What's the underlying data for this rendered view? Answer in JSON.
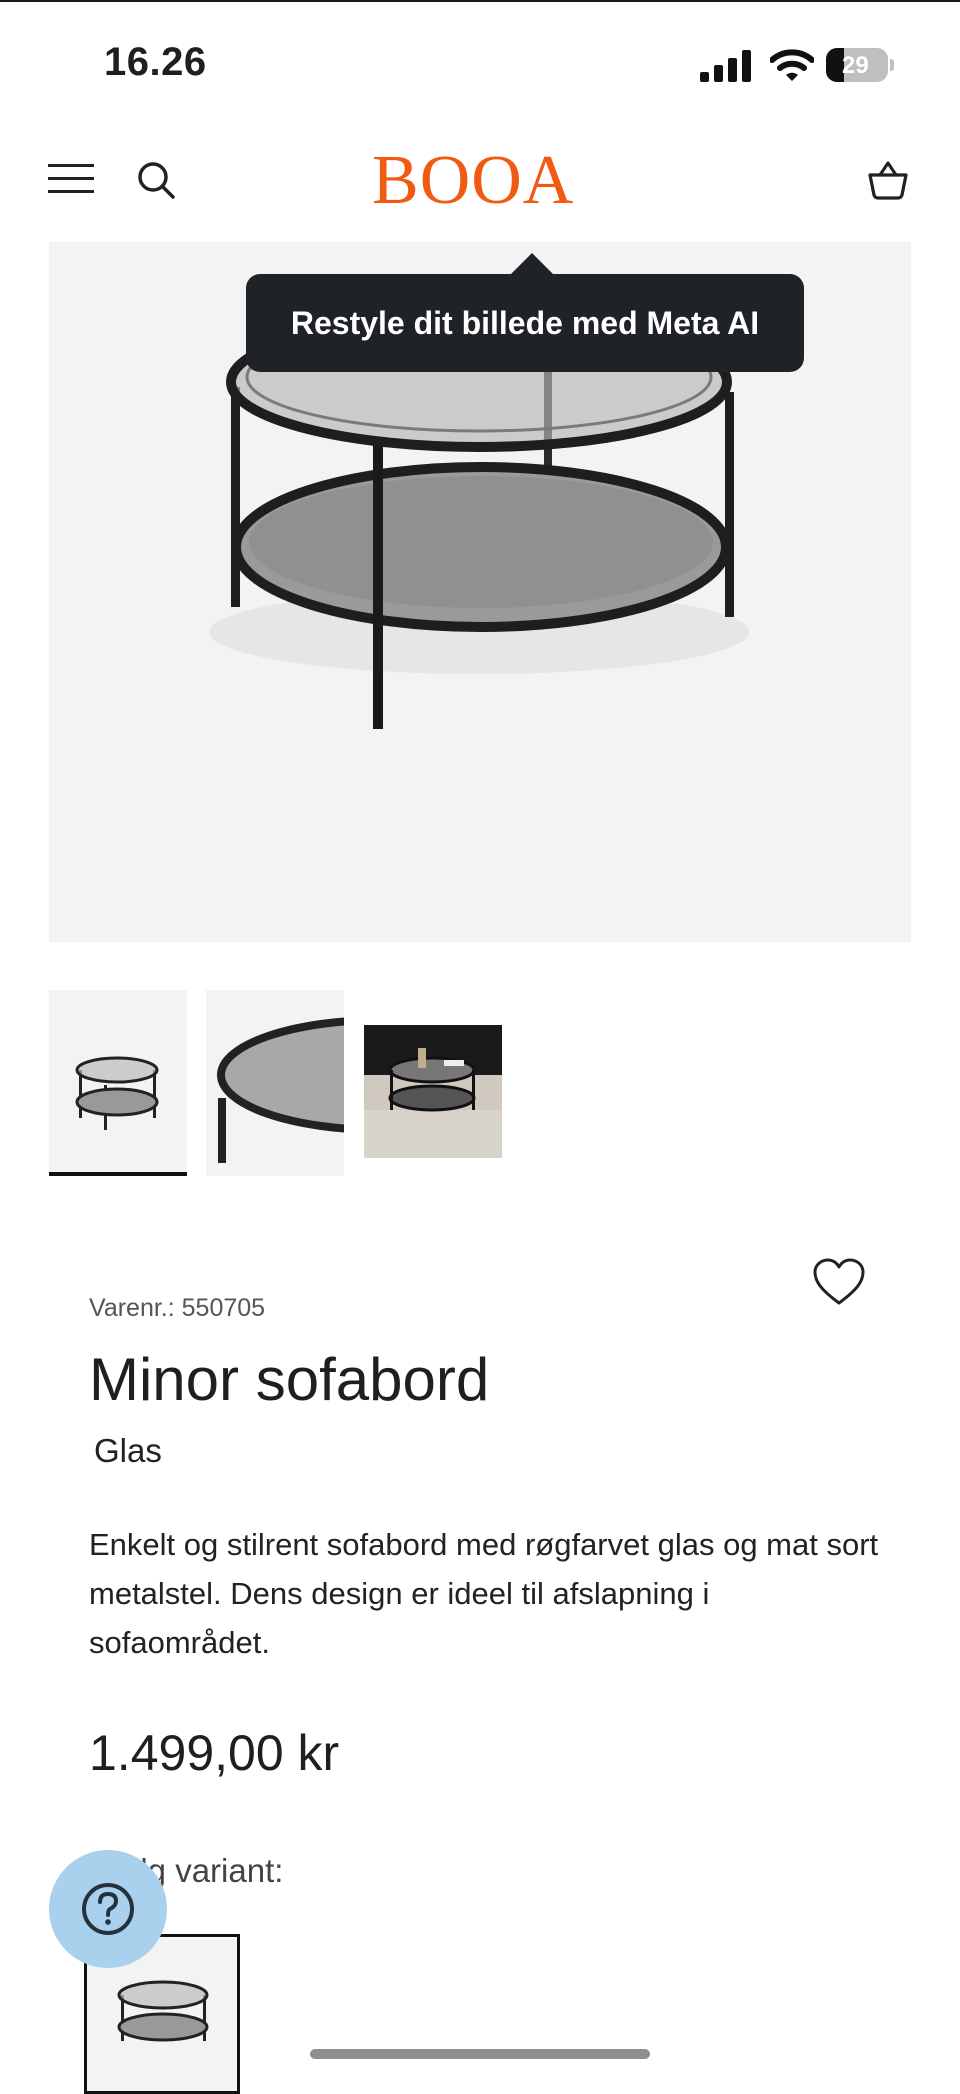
{
  "status_bar": {
    "time": "16.26",
    "battery": "29",
    "battery_level": 0.29,
    "icons": [
      "cellular-signal-icon",
      "wifi-icon",
      "battery-icon"
    ]
  },
  "header": {
    "logo": "BOOA",
    "brand_color": "#f05a12",
    "icons": [
      "hamburger-menu-icon",
      "search-icon",
      "shopping-basket-icon"
    ]
  },
  "hero": {
    "tooltip": "Restyle dit billede med Meta AI"
  },
  "thumbnails": {
    "count": 3,
    "selected_index": 0
  },
  "product": {
    "sku": "Varenr.: 550705",
    "title": "Minor sofabord",
    "subtitle": "Glas",
    "description": "Enkelt og stilrent sofabord med røgfarvet glas og mat sort metalstel. Dens design er ideel til afslapning i sofaområdet.",
    "price": "1.499,00 kr",
    "variant_label": "Vælg variant:"
  },
  "colors": {
    "help_button": "#a9d0ec",
    "tooltip_bg": "#1f2226"
  }
}
